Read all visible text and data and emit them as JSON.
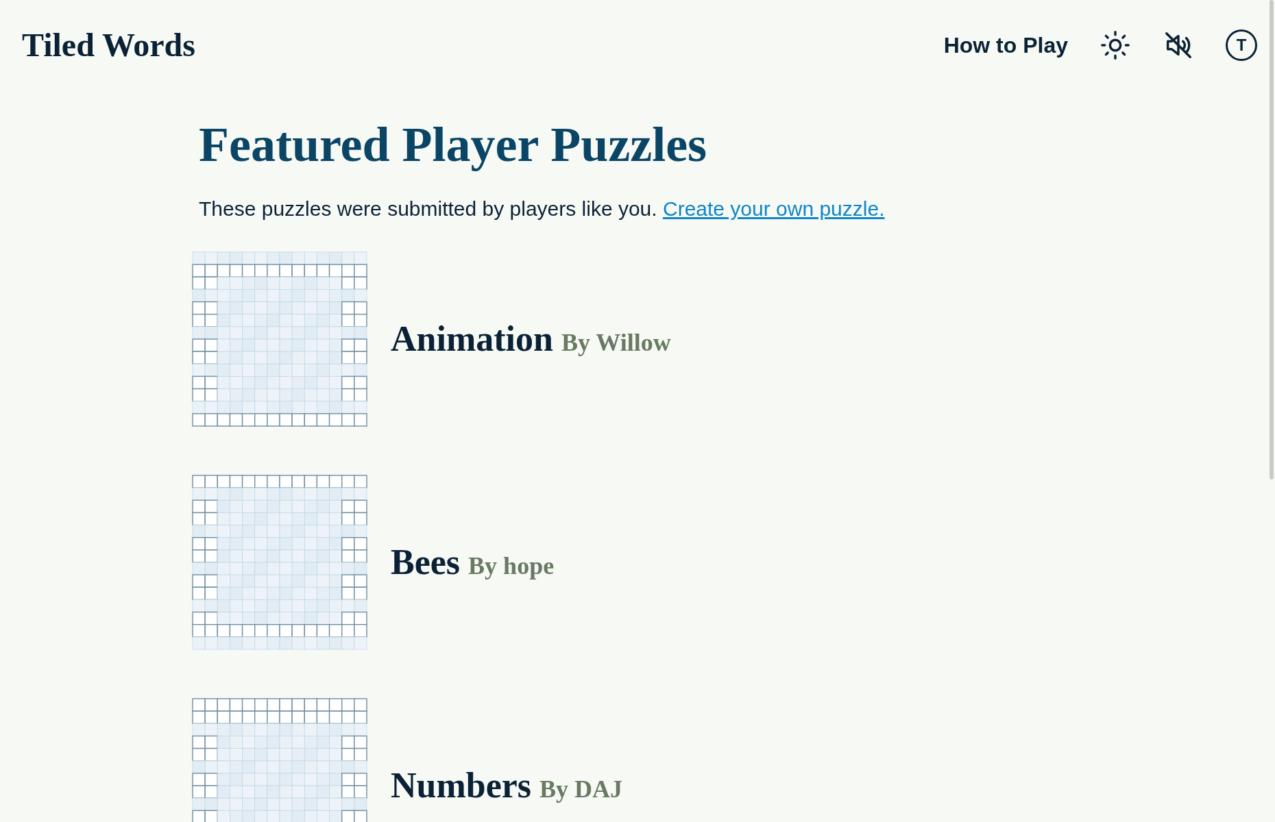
{
  "site_title": "Tiled Words",
  "nav": {
    "how_to_play": "How to Play",
    "avatar_letter": "T",
    "sound_muted": true
  },
  "heading": "Featured Player Puzzles",
  "intro": {
    "text": "These puzzles were submitted by players like you.",
    "link": "Create your own puzzle."
  },
  "puzzles": [
    {
      "title": "Animation",
      "by": "By Willow"
    },
    {
      "title": "Bees",
      "by": "By hope"
    },
    {
      "title": "Numbers",
      "by": "By DAJ"
    }
  ]
}
